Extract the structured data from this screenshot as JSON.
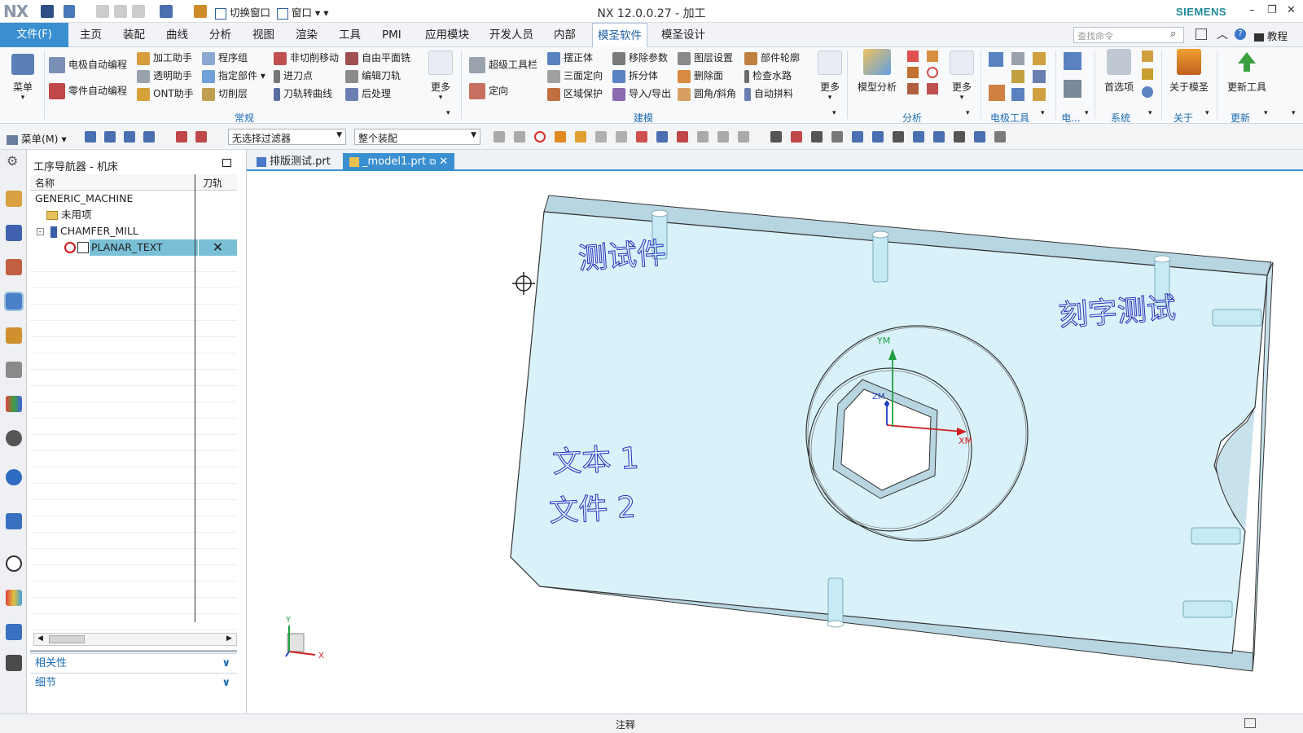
{
  "app": {
    "logo": "NX",
    "window_title": "NX 12.0.0.27 - 加工",
    "brand": "SIEMENS",
    "quick_access": {
      "switch_window": "切换窗口",
      "window": "窗口"
    }
  },
  "menu": {
    "file": "文件(F)",
    "tabs": [
      "主页",
      "装配",
      "曲线",
      "分析",
      "视图",
      "渲染",
      "工具",
      "PMI",
      "应用模块",
      "开发人员",
      "内部",
      "模圣软件",
      "模圣设计"
    ],
    "active_tab": "模圣软件",
    "search_placeholder": "查找命令",
    "tutorial": "教程"
  },
  "ribbon": {
    "menu_btn": "菜单",
    "changgui": {
      "col1": [
        "电极自动编程",
        "零件自动编程"
      ],
      "col2": [
        "加工助手",
        "透明助手",
        "ONT助手"
      ],
      "col3": [
        "程序组",
        "指定部件",
        "切削层"
      ],
      "col4": [
        "非切削移动",
        "进刀点",
        "刀轨转曲线"
      ],
      "col5": [
        "自由平面铣",
        "编辑刀轨",
        "后处理"
      ],
      "more": "更多",
      "group": "常规"
    },
    "jianmo": {
      "col1": [
        "超级工具栏",
        "定向"
      ],
      "col2": [
        "摆正体",
        "三面定向",
        "区域保护"
      ],
      "col3": [
        "移除参数",
        "拆分体",
        "导入/导出"
      ],
      "col4": [
        "图层设置",
        "删除面",
        "圆角/斜角"
      ],
      "col5": [
        "部件轮廓",
        "检查水路",
        "自动拼料"
      ],
      "more": "更多",
      "group": "建模"
    },
    "fenxi": {
      "model_analysis": "模型分析",
      "more": "更多",
      "group": "分析"
    },
    "dianji": {
      "group": "电极工具",
      "group2": "电..."
    },
    "xitong": {
      "prefs": "首选项",
      "group": "系统"
    },
    "guanyu": {
      "about": "关于模圣",
      "group": "关于"
    },
    "gengxin": {
      "update": "更新工具",
      "group": "更新"
    }
  },
  "toolbar2": {
    "menu": "菜单(M)",
    "filter": "无选择过滤器",
    "assembly": "整个装配"
  },
  "navigator": {
    "title": "工序导航器 - 机床",
    "col_name": "名称",
    "col_path": "刀轨",
    "rows": [
      {
        "name": "GENERIC_MACHINE"
      },
      {
        "name": "未用项"
      },
      {
        "name": "CHAMFER_MILL"
      },
      {
        "name": "PLANAR_TEXT",
        "path": "✕"
      }
    ],
    "accordion": [
      "相关性",
      "细节"
    ]
  },
  "doc_tabs": [
    "排版测试.prt",
    "_model1.prt"
  ],
  "viewport": {
    "engraving": [
      "测试件",
      "刻字测试",
      "文本 1",
      "文件 2"
    ],
    "csys": {
      "x": "XM",
      "y": "YM",
      "z": "ZM"
    },
    "triad": {
      "x": "X",
      "y": "Y"
    },
    "colors": {
      "part_fill": "#d9f2fa",
      "part_edge": "#333333",
      "side": "#b8d6e2",
      "text_ink": "#2d2db8",
      "x_axis": "#d02020",
      "y_axis": "#20a040",
      "z_axis": "#2040c0"
    }
  },
  "status": {
    "center": "注释"
  }
}
